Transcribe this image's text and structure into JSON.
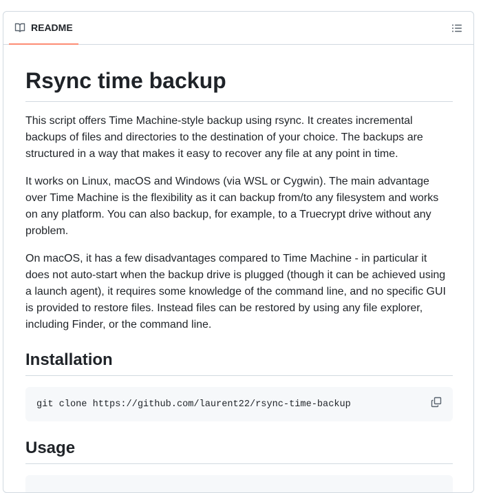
{
  "readme_tab": {
    "label": "README",
    "icon": "book-icon",
    "accent_color": "#fd8c73"
  },
  "toc_button": {
    "icon": "list-unordered-icon"
  },
  "article": {
    "title": "Rsync time backup",
    "intro_paragraphs": [
      "This script offers Time Machine-style backup using rsync. It creates incremental backups of files and directories to the destination of your choice. The backups are structured in a way that makes it easy to recover any file at any point in time.",
      "It works on Linux, macOS and Windows (via WSL or Cygwin). The main advantage over Time Machine is the flexibility as it can backup from/to any filesystem and works on any platform. You can also backup, for example, to a Truecrypt drive without any problem.",
      "On macOS, it has a few disadvantages compared to Time Machine - in particular it does not auto-start when the backup drive is plugged (though it can be achieved using a launch agent), it requires some knowledge of the command line, and no specific GUI is provided to restore files. Instead files can be restored by using any file explorer, including Finder, or the command line."
    ],
    "installation": {
      "heading": "Installation",
      "code": "git clone https://github.com/laurent22/rsync-time-backup",
      "copy_icon": "copy-icon"
    },
    "usage": {
      "heading": "Usage"
    }
  }
}
